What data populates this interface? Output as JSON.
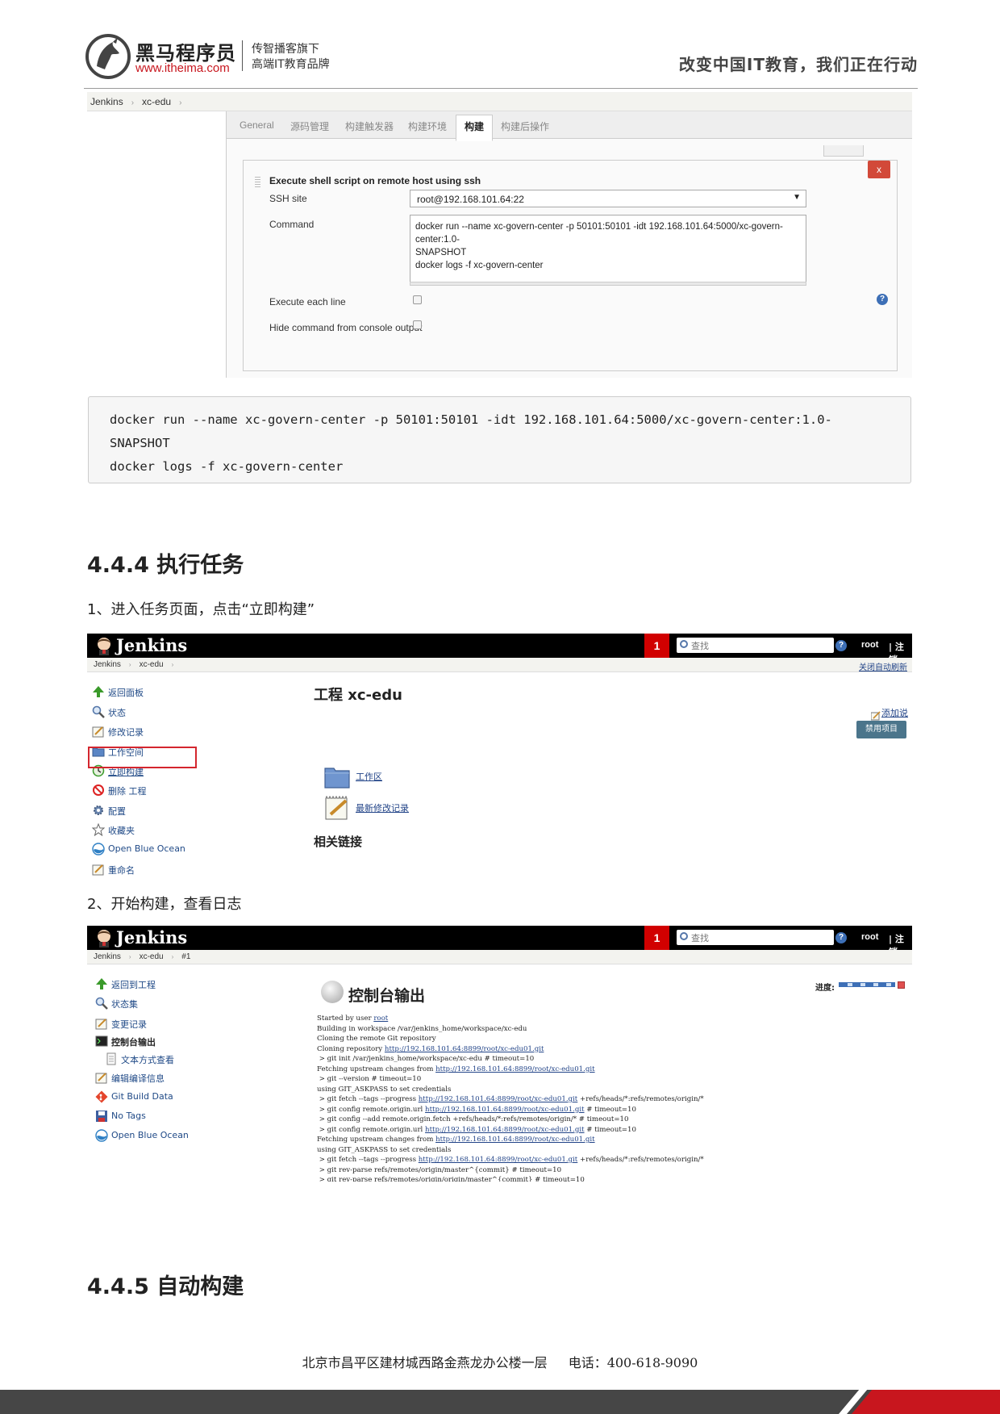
{
  "header": {
    "brand": "黑马程序员",
    "url": "www.itheima.com",
    "slogan_line1": "传智播客旗下",
    "slogan_line2": "高端IT教育品牌",
    "motto": "改变中国IT教育，我们正在行动"
  },
  "config_screenshot": {
    "breadcrumb": [
      "Jenkins",
      "xc-edu"
    ],
    "tabs": [
      "General",
      "源码管理",
      "构建触发器",
      "构建环境",
      "构建",
      "构建后操作"
    ],
    "active_tab": "构建",
    "panel_title": "Execute shell script on remote host using ssh",
    "delete_label": "x",
    "ssh_site_label": "SSH site",
    "ssh_site_value": "root@192.168.101.64:22",
    "command_label": "Command",
    "command_lines": [
      "docker run --name xc-govern-center -p 50101:50101 -idt 192.168.101.64:5000/xc-govern-center:1.0-",
      "SNAPSHOT",
      "docker logs -f xc-govern-center"
    ],
    "execute_each_line_label": "Execute each line",
    "hide_command_label": "Hide command from console output",
    "help_icon": "?"
  },
  "code_block": {
    "lines": [
      "docker run --name xc-govern-center -p 50101:50101 -idt 192.168.101.64:5000/xc-govern-center:1.0-",
      "SNAPSHOT",
      "docker logs -f xc-govern-center"
    ]
  },
  "section_444": {
    "heading": "4.4.4 执行任务",
    "step1": "1、进入任务页面，点击“立即构建”",
    "step2": "2、开始构建，查看日志"
  },
  "jenkins_common": {
    "title": "Jenkins",
    "badge": "1",
    "search_placeholder": "查找",
    "help": "?",
    "user": "root",
    "logout": "| 注销"
  },
  "job_page": {
    "breadcrumb": [
      "Jenkins",
      "xc-edu"
    ],
    "auto_refresh": "关闭自动刷新",
    "sidebar": [
      {
        "label": "返回面板",
        "icon": "up-arrow-icon"
      },
      {
        "label": "状态",
        "icon": "magnifier-icon"
      },
      {
        "label": "修改记录",
        "icon": "notepad-icon"
      },
      {
        "label": "工作空间",
        "icon": "folder-icon"
      },
      {
        "label": "立即构建",
        "icon": "build-clock-icon"
      },
      {
        "label": "删除 工程",
        "icon": "no-entry-icon"
      },
      {
        "label": "配置",
        "icon": "gear-icon"
      },
      {
        "label": "收藏夹",
        "icon": "star-icon"
      },
      {
        "label": "Open Blue Ocean",
        "icon": "blue-ocean-icon"
      },
      {
        "label": "重命名",
        "icon": "notepad-icon"
      }
    ],
    "title": "工程 xc-edu",
    "add_description": "添加说明",
    "disable_project": "禁用项目",
    "workspace_link": "工作区",
    "recent_changes_link": "最新修改记录",
    "related_links": "相关链接"
  },
  "console_page": {
    "breadcrumb": [
      "Jenkins",
      "xc-edu",
      "#1"
    ],
    "sidebar": [
      {
        "label": "返回到工程",
        "icon": "up-arrow-icon"
      },
      {
        "label": "状态集",
        "icon": "magnifier-icon"
      },
      {
        "label": "变更记录",
        "icon": "notepad-icon"
      },
      {
        "label": "控制台输出",
        "icon": "terminal-icon"
      },
      {
        "label": "文本方式查看",
        "icon": "document-icon"
      },
      {
        "label": "编辑编译信息",
        "icon": "notepad-icon"
      },
      {
        "label": "Git Build Data",
        "icon": "git-icon"
      },
      {
        "label": "No Tags",
        "icon": "floppy-icon"
      },
      {
        "label": "Open Blue Ocean",
        "icon": "blue-ocean-icon"
      }
    ],
    "title": "控制台输出",
    "progress_label": "进度:",
    "console_lines": [
      [
        {
          "t": "Started by user "
        },
        {
          "t": "root",
          "link": true
        }
      ],
      [
        {
          "t": "Building in workspace /var/jenkins_home/workspace/xc-edu"
        }
      ],
      [
        {
          "t": "Cloning the remote Git repository"
        }
      ],
      [
        {
          "t": "Cloning repository "
        },
        {
          "t": "http://192.168.101.64:8899/root/xc-edu01.git",
          "link": true
        }
      ],
      [
        {
          "t": " > git init /var/jenkins_home/workspace/xc-edu # timeout=10"
        }
      ],
      [
        {
          "t": "Fetching upstream changes from "
        },
        {
          "t": "http://192.168.101.64:8899/root/xc-edu01.git",
          "link": true
        }
      ],
      [
        {
          "t": " > git --version # timeout=10"
        }
      ],
      [
        {
          "t": "using GIT_ASKPASS to set credentials"
        }
      ],
      [
        {
          "t": " > git fetch --tags --progress "
        },
        {
          "t": "http://192.168.101.64:8899/root/xc-edu01.git",
          "link": true
        },
        {
          "t": " +refs/heads/*:refs/remotes/origin/*"
        }
      ],
      [
        {
          "t": " > git config remote.origin.url "
        },
        {
          "t": "http://192.168.101.64:8899/root/xc-edu01.git",
          "link": true
        },
        {
          "t": " # timeout=10"
        }
      ],
      [
        {
          "t": " > git config --add remote.origin.fetch +refs/heads/*:refs/remotes/origin/* # timeout=10"
        }
      ],
      [
        {
          "t": " > git config remote.origin.url "
        },
        {
          "t": "http://192.168.101.64:8899/root/xc-edu01.git",
          "link": true
        },
        {
          "t": " # timeout=10"
        }
      ],
      [
        {
          "t": "Fetching upstream changes from "
        },
        {
          "t": "http://192.168.101.64:8899/root/xc-edu01.git",
          "link": true
        }
      ],
      [
        {
          "t": "using GIT_ASKPASS to set credentials"
        }
      ],
      [
        {
          "t": " > git fetch --tags --progress "
        },
        {
          "t": "http://192.168.101.64:8899/root/xc-edu01.git",
          "link": true
        },
        {
          "t": " +refs/heads/*:refs/remotes/origin/*"
        }
      ],
      [
        {
          "t": " > git rev-parse refs/remotes/origin/master^{commit} # timeout=10"
        }
      ],
      [
        {
          "t": " > git rev-parse refs/remotes/origin/origin/master^{commit} # timeout=10"
        }
      ]
    ]
  },
  "section_445": {
    "heading": "4.4.5 自动构建"
  },
  "footer": {
    "address": "北京市昌平区建材城西路金燕龙办公楼一层",
    "phone": "电话：400-618-9090"
  }
}
